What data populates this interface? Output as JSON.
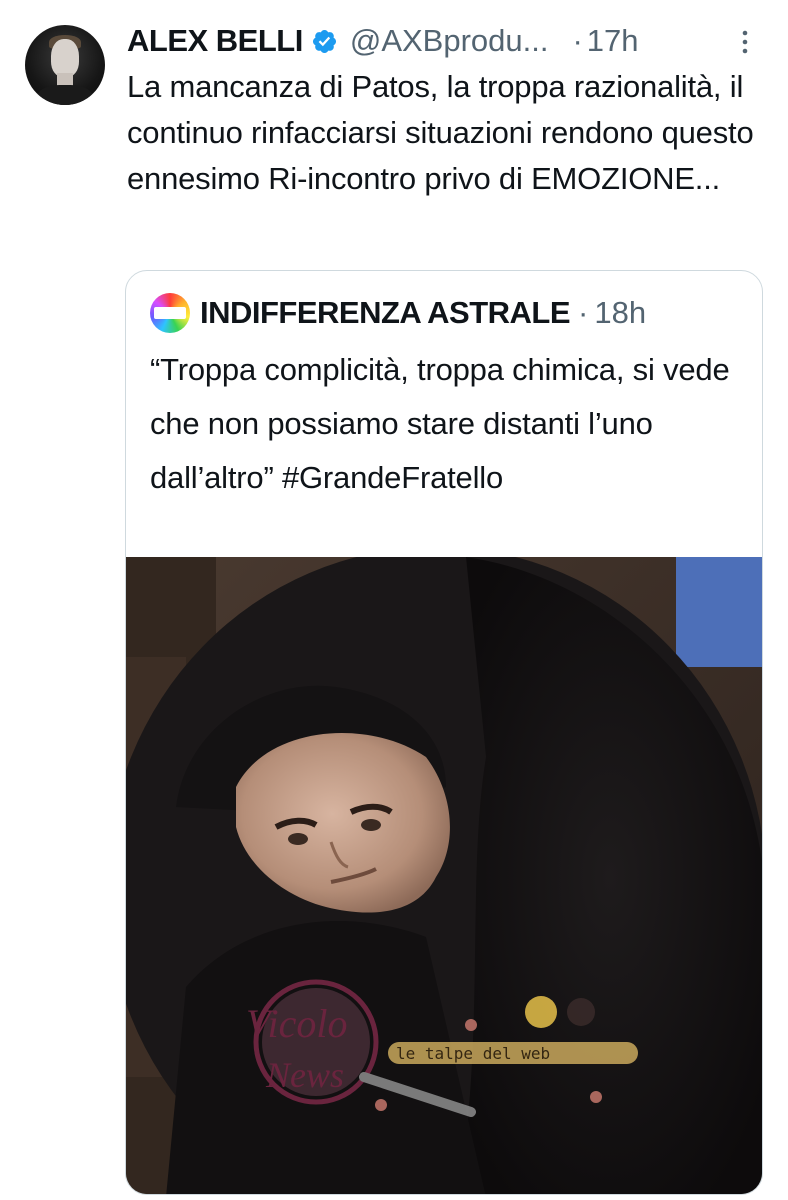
{
  "tweet": {
    "author_name": "ALEX BELLI",
    "handle": "@AXBprodu...",
    "separator": "·",
    "time": "17h",
    "text": "La mancanza di Patos, la troppa razionalità, il continuo rinfacciarsi situazioni rendono questo ennesimo Ri-incontro privo di EMOZIONE..."
  },
  "quote": {
    "author_name": "INDIFFERENZA ASTRALE",
    "separator": "·",
    "time": "18h",
    "text": "“Troppa complicità, troppa chimica, si vede che non possiamo stare distanti l’uno dall’altro” #GrandeFratello"
  },
  "watermarks": {
    "left_logo": "Vicolo delle News",
    "right_logo": "le talpe del web"
  },
  "colors": {
    "text_primary": "#0f1419",
    "text_secondary": "#536471",
    "verified_blue": "#1d9bf0",
    "border": "#cfd9de"
  },
  "icons": {
    "verified": "verified-badge-icon",
    "more": "more-options-icon"
  }
}
